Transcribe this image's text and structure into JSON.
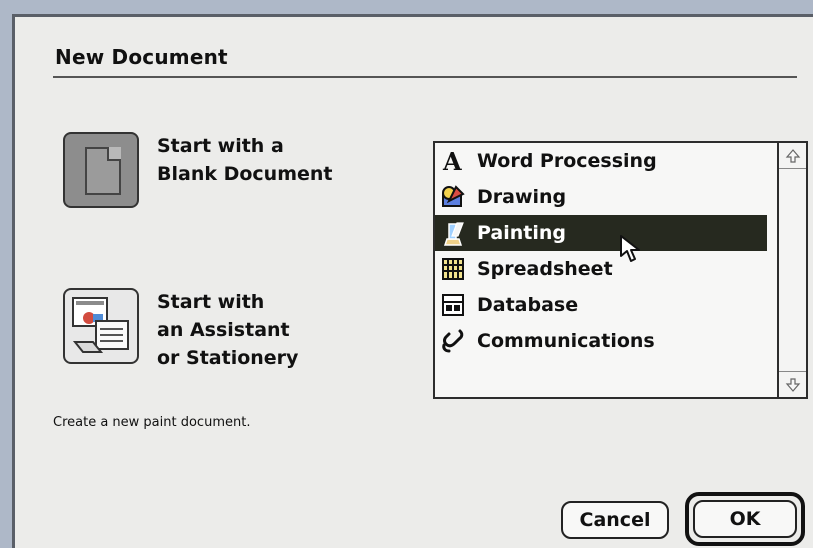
{
  "dialog": {
    "title": "New Document",
    "description": "Create a new paint document."
  },
  "choices": [
    {
      "icon": "blank-document-icon",
      "label": "Start with a\nBlank Document"
    },
    {
      "icon": "assistant-stationery-icon",
      "label": "Start with\nan Assistant\nor Stationery"
    }
  ],
  "list": {
    "items": [
      {
        "label": "Word Processing",
        "icon": "word-processing-icon",
        "selected": false
      },
      {
        "label": "Drawing",
        "icon": "drawing-icon",
        "selected": false
      },
      {
        "label": "Painting",
        "icon": "painting-icon",
        "selected": true
      },
      {
        "label": "Spreadsheet",
        "icon": "spreadsheet-icon",
        "selected": false
      },
      {
        "label": "Database",
        "icon": "database-icon",
        "selected": false
      },
      {
        "label": "Communications",
        "icon": "communications-icon",
        "selected": false
      }
    ]
  },
  "buttons": {
    "cancel": "Cancel",
    "ok": "OK"
  },
  "colors": {
    "dialog_bg": "#ececea",
    "selection_bg": "#26291f",
    "selection_text": "#ffffff"
  }
}
